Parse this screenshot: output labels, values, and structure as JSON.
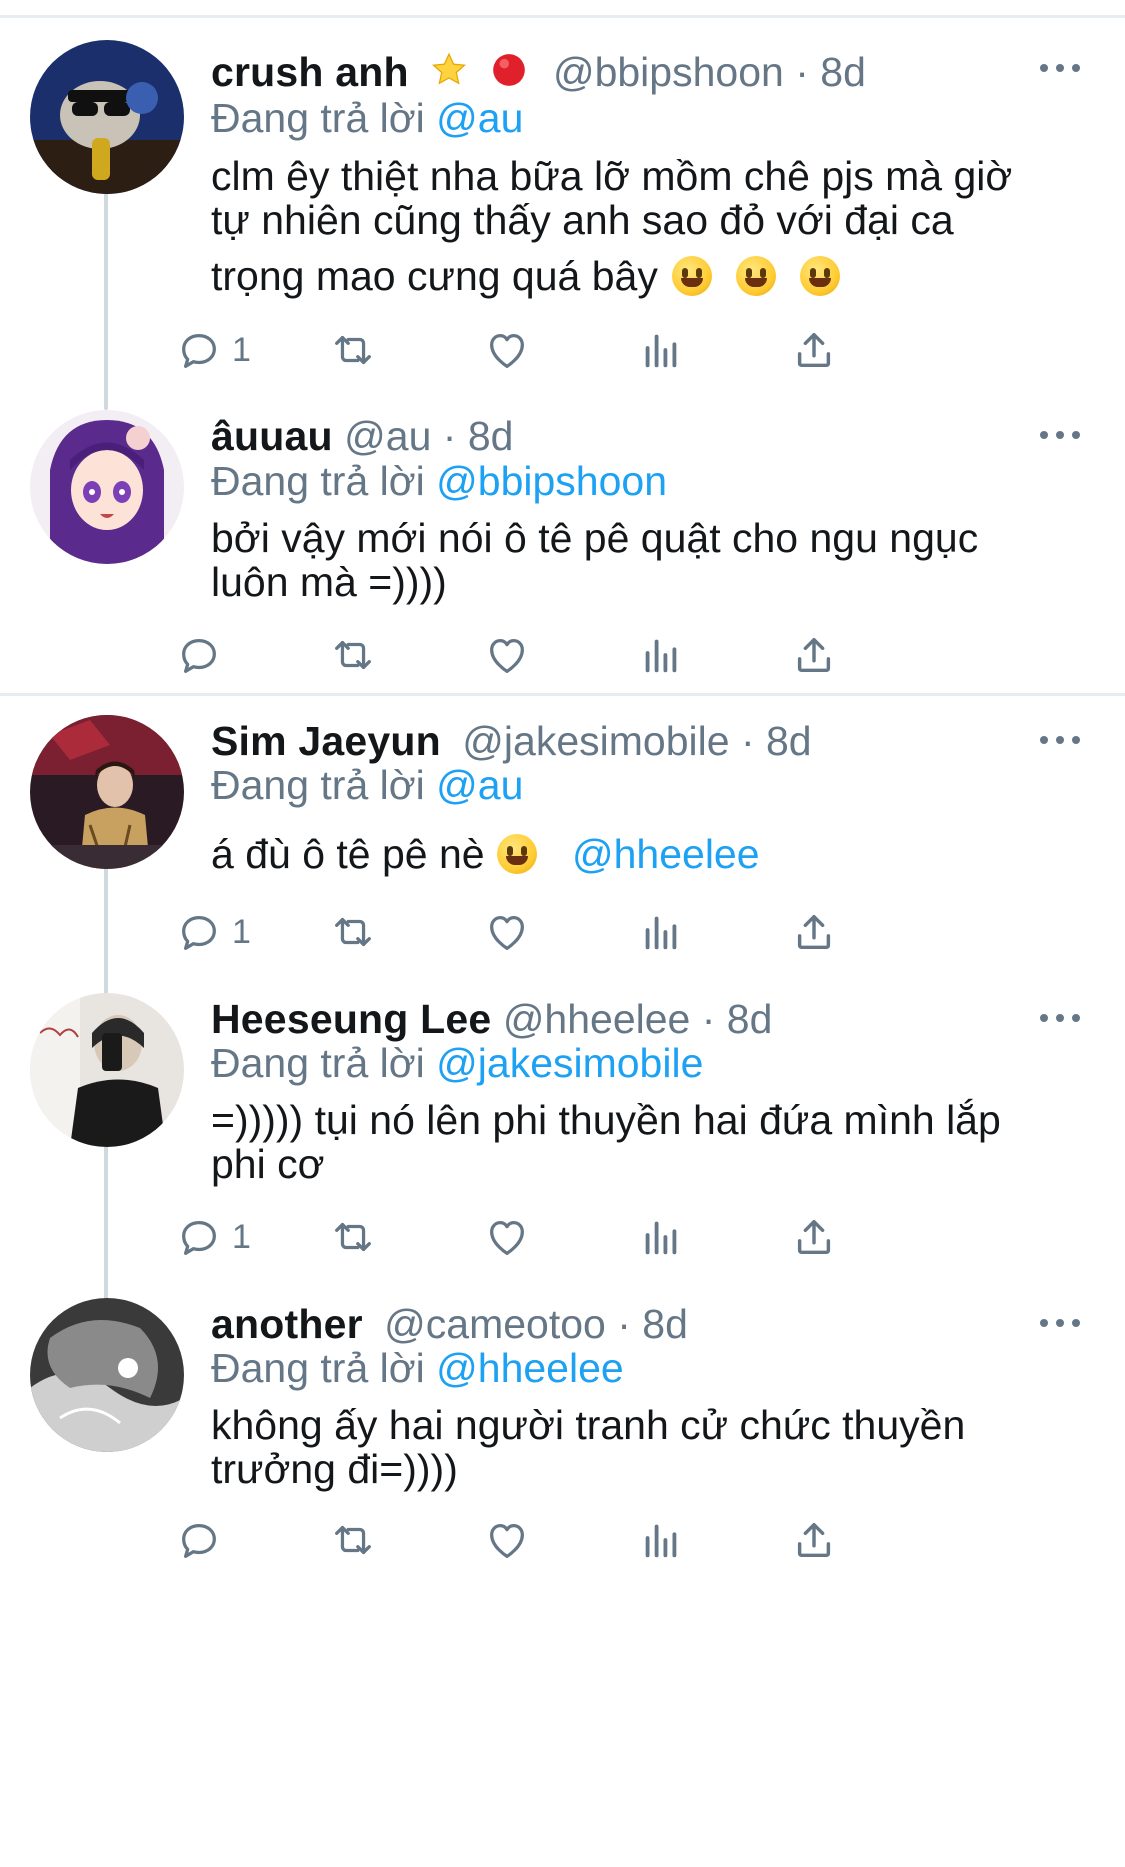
{
  "tweets": [
    {
      "name": "crush anh",
      "handle": "@bbipshoon",
      "time": "· 8d",
      "reply_prefix": "Đang trả lời",
      "reply_to": "@au",
      "lines": [
        "clm êy thiệt nha bữa lỡ mồm chê pjs mà giờ",
        "tự nhiên cũng thấy anh sao đỏ với đại ca",
        "trọng mao cưng quá bây"
      ],
      "reply_count": "1"
    },
    {
      "name": "âuuau",
      "handle": "@au",
      "time": "· 8d",
      "reply_prefix": "Đang trả lời",
      "reply_to": "@bbipshoon",
      "lines": [
        "bởi vậy mới nói ô tê pê quật cho ngu ngục",
        "luôn mà =))))"
      ],
      "reply_count": ""
    },
    {
      "name": "Sim Jaeyun",
      "handle": "@jakesimobile",
      "time": "· 8d",
      "reply_prefix": "Đang trả lời",
      "reply_to": "@au",
      "lines": [
        "á đù ô tê pê nè"
      ],
      "inline_mention": "@hheelee",
      "reply_count": "1"
    },
    {
      "name": "Heeseung Lee",
      "handle": "@hheelee",
      "time": "· 8d",
      "reply_prefix": "Đang trả lời",
      "reply_to": "@jakesimobile",
      "lines": [
        "=))))) tụi nó lên phi thuyền hai đứa mình lắp",
        "phi cơ"
      ],
      "reply_count": "1"
    },
    {
      "name": "another",
      "handle": "@cameotoo",
      "time": "· 8d",
      "reply_prefix": "Đang trả lời",
      "reply_to": "@hheelee",
      "lines": [
        "không ấy hai người tranh cử chức thuyền",
        "trưởng đi=))))"
      ],
      "reply_count": ""
    }
  ],
  "icons": {
    "reply": "reply-icon",
    "retweet": "retweet-icon",
    "like": "heart-icon",
    "views": "views-icon",
    "share": "share-icon",
    "more": "more-icon",
    "star_badge": "star-badge-icon",
    "red_badge": "red-circle-badge-icon",
    "emoji": "grinning-face-emoji"
  },
  "colors": {
    "accent": "#1da1f2",
    "secondary_text": "#657786",
    "divider": "#e6ecf0"
  }
}
